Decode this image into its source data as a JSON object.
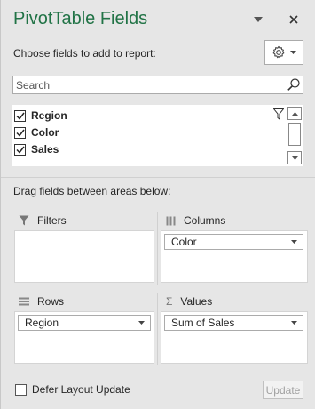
{
  "header": {
    "title": "PivotTable Fields",
    "options_icon": "dropdown-triangle-icon",
    "close_icon": "close-icon"
  },
  "choose_label": "Choose fields to add to report:",
  "tools_button": {
    "icon": "gear-icon"
  },
  "search": {
    "placeholder": "Search",
    "icon": "search-icon"
  },
  "fields": [
    {
      "label": "Region",
      "checked": true
    },
    {
      "label": "Color",
      "checked": true
    },
    {
      "label": "Sales",
      "checked": true
    }
  ],
  "drag_label": "Drag fields between areas below:",
  "areas": {
    "filters": {
      "title": "Filters",
      "icon": "filter-icon",
      "items": []
    },
    "columns": {
      "title": "Columns",
      "icon": "columns-icon",
      "items": [
        "Color"
      ]
    },
    "rows": {
      "title": "Rows",
      "icon": "rows-icon",
      "items": [
        "Region"
      ]
    },
    "values": {
      "title": "Values",
      "icon": "sigma-icon",
      "items": [
        "Sum of Sales"
      ]
    }
  },
  "defer": {
    "label": "Defer Layout Update",
    "checked": false
  },
  "update_button": {
    "label": "Update",
    "enabled": false
  },
  "colors": {
    "title": "#217346",
    "background": "#e6e6e6"
  }
}
